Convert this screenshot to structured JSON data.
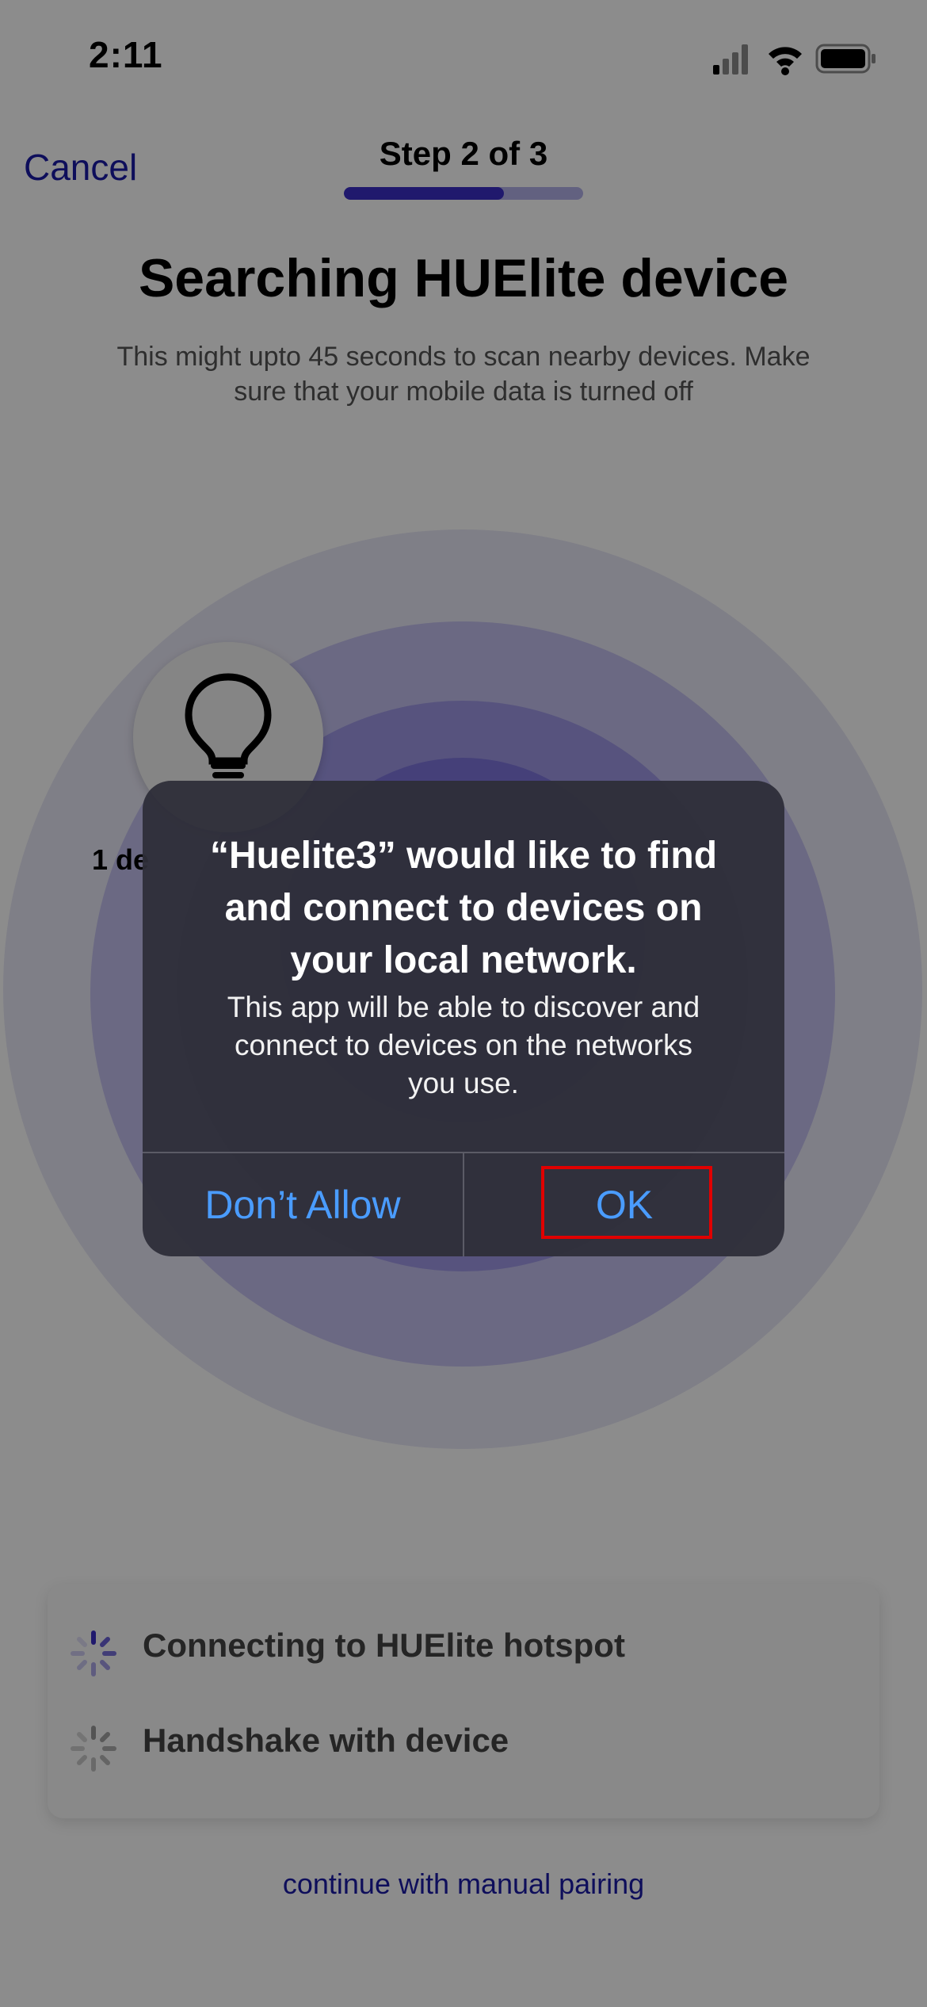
{
  "status_bar": {
    "time": "2:11",
    "icons": [
      "cellular-signal-icon",
      "wifi-icon",
      "battery-icon"
    ]
  },
  "header": {
    "cancel_label": "Cancel",
    "step_label": "Step 2 of 3",
    "progress_fraction": 0.67,
    "progress_color": "#3b2fc6",
    "progress_track_color": "#b3b1ea"
  },
  "main": {
    "title": "Searching HUElite device",
    "subtitle_line1": "This might upto 45 seconds to scan nearby devices. Make",
    "subtitle_line2": "sure that your mobile data is turned off",
    "found_label": "1 de",
    "device_icon": "lightbulb-icon"
  },
  "steps_card": {
    "items": [
      {
        "label": "Connecting to HUElite hotspot",
        "icon": "spinner-icon",
        "accent": "#3b2fc6"
      },
      {
        "label": "Handshake with device",
        "icon": "spinner-icon",
        "accent": "#9a9a9a"
      }
    ]
  },
  "manual_link": "continue with manual pairing",
  "alert": {
    "title_lines": [
      "“Huelite3” would like to find",
      "and connect to devices on",
      "your local network."
    ],
    "message_lines": [
      "This app will be able to discover and",
      "connect to devices on the networks",
      "you use."
    ],
    "deny_label": "Don’t Allow",
    "ok_label": "OK",
    "button_color": "#4a9cff",
    "highlight_color": "#e00000"
  }
}
